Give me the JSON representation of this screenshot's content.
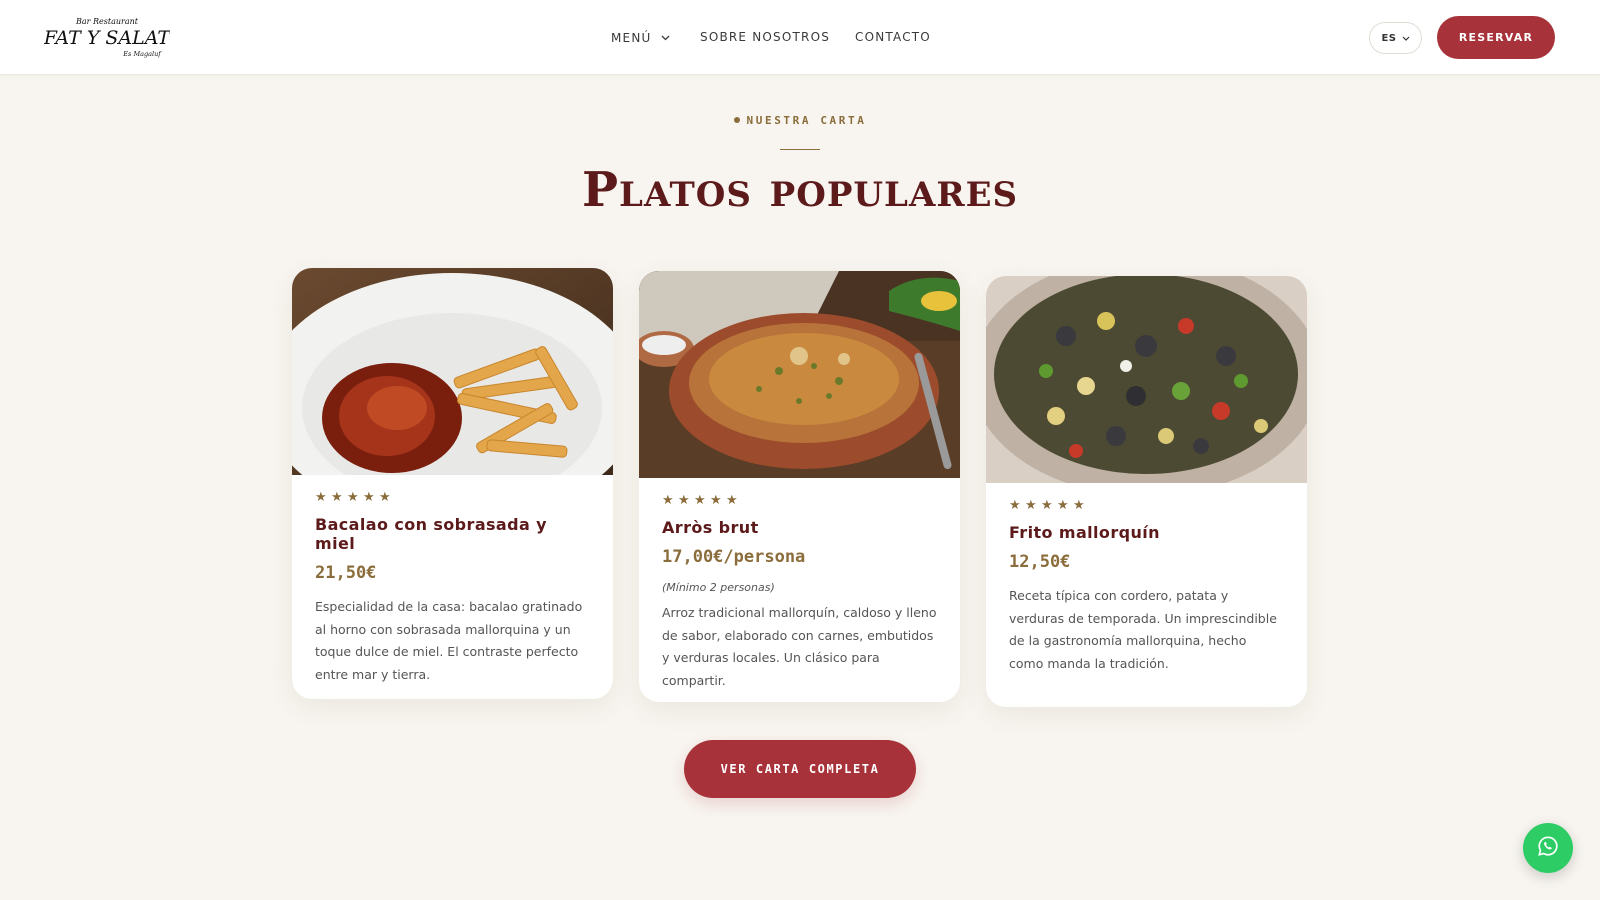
{
  "header": {
    "logo": {
      "line1": "Bar Restaurant",
      "line2": "FAT Y SALAT",
      "line3": "Es Magaluf"
    },
    "nav": {
      "menu_label": "MENÚ",
      "about_label": "SOBRE NOSOTROS",
      "contact_label": "CONTACTO"
    },
    "language": "ES",
    "reserve_label": "RESERVAR"
  },
  "section": {
    "eyebrow": "NUESTRA CARTA",
    "title": "Platos populares"
  },
  "cards": [
    {
      "image": "chicken-with-fries-photo",
      "rating": 5,
      "name": "Bacalao con sobrasada y miel",
      "price": "21,50€",
      "note": "",
      "description": "Especialidad de la casa: bacalao gratinado al horno con sobrasada mallorquina y un toque dulce de miel. El contraste perfecto entre mar y tierra."
    },
    {
      "image": "rice-stew-bowl-photo",
      "rating": 5,
      "name": "Arròs brut",
      "price": "17,00€/persona",
      "note": "(Mínimo 2 personas)",
      "description": "Arroz tradicional mallorquín, caldoso y lleno de sabor, elaborado con carnes, embutidos y verduras locales. Un clásico para compartir."
    },
    {
      "image": "frito-mallorquin-photo",
      "rating": 5,
      "name": "Frito mallorquín",
      "price": "12,50€",
      "note": "",
      "description": "Receta típica con cordero, patata y verduras de temporada. Un imprescindible de la gastronomía mallorquina, hecho como manda la tradición."
    }
  ],
  "cta_label": "VER CARTA COMPLETA",
  "floating": {
    "icon": "whatsapp-icon"
  },
  "colors": {
    "accent": "#a8323a",
    "heading": "#5c1a1b",
    "gold": "#8a6d3b",
    "background": "#f8f5f0",
    "whatsapp": "#2ecc64"
  }
}
